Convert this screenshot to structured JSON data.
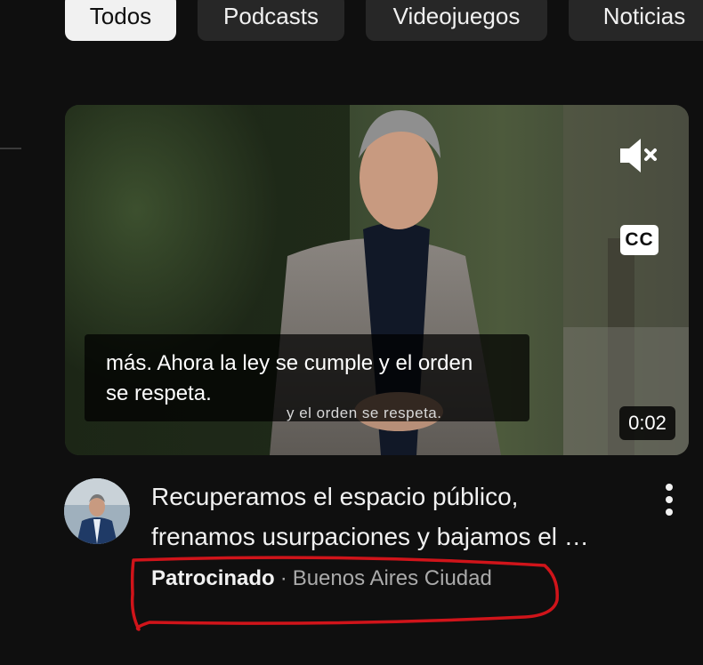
{
  "filters": {
    "chips": [
      {
        "label": "Todos",
        "active": true
      },
      {
        "label": "Podcasts",
        "active": false
      },
      {
        "label": "Videojuegos",
        "active": false
      },
      {
        "label": "Noticias",
        "active": false
      }
    ]
  },
  "video": {
    "caption_line1": "más. Ahora la ley se cumple y el orden",
    "caption_line2": "se respeta.",
    "burned_subtitle": "y el orden se respeta.",
    "cc_label": "CC",
    "duration": "0:02",
    "mute_icon": "speaker-muted-icon"
  },
  "ad": {
    "title_line1": "Recuperamos el espacio público,",
    "title_line2": "frenamos usurpaciones y bajamos el …",
    "sponsored_label": "Patrocinado",
    "separator": "·",
    "channel": "Buenos Aires Ciudad",
    "menu_icon": "more-vert-icon"
  },
  "annotation": {
    "color": "#d0141a",
    "shape": "hand-drawn-ellipse"
  }
}
